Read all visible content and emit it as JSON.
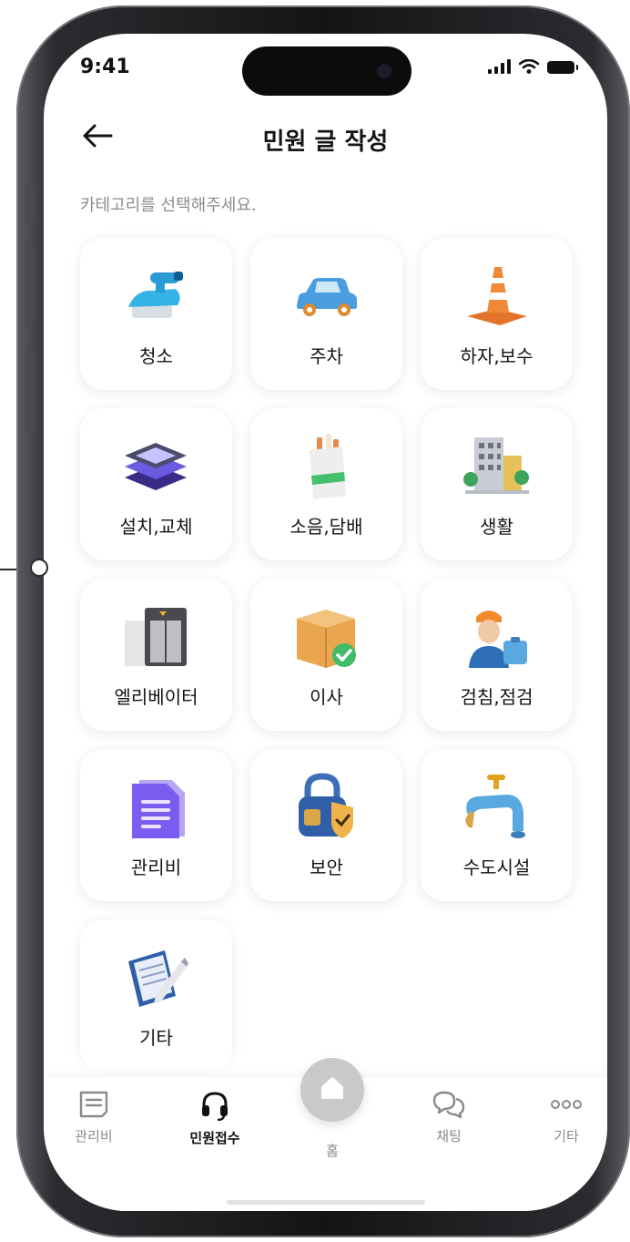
{
  "status_bar": {
    "time": "9:41"
  },
  "header": {
    "title": "민원 글 작성",
    "subtitle": "카테고리를 선택해주세요."
  },
  "categories": [
    {
      "label": "청소",
      "icon": "cleaning-brush-icon"
    },
    {
      "label": "주차",
      "icon": "car-icon"
    },
    {
      "label": "하자,보수",
      "icon": "traffic-cone-icon"
    },
    {
      "label": "설치,교체",
      "icon": "layers-icon"
    },
    {
      "label": "소음,담배",
      "icon": "cigarette-pack-icon"
    },
    {
      "label": "생활",
      "icon": "building-icon"
    },
    {
      "label": "엘리베이터",
      "icon": "elevator-icon"
    },
    {
      "label": "이사",
      "icon": "moving-box-icon"
    },
    {
      "label": "검침,점검",
      "icon": "inspector-icon"
    },
    {
      "label": "관리비",
      "icon": "document-icon"
    },
    {
      "label": "보안",
      "icon": "lock-shield-icon"
    },
    {
      "label": "수도시설",
      "icon": "faucet-icon"
    },
    {
      "label": "기타",
      "icon": "notepad-pencil-icon"
    }
  ],
  "nav": {
    "items": [
      {
        "label": "관리비",
        "icon": "receipt-icon",
        "active": false
      },
      {
        "label": "민원접수",
        "icon": "headset-icon",
        "active": true
      },
      {
        "label": "홈",
        "icon": "home-icon",
        "active": false
      },
      {
        "label": "채팅",
        "icon": "chat-icon",
        "active": false
      },
      {
        "label": "기타",
        "icon": "more-dots-icon",
        "active": false
      }
    ]
  },
  "colors": {
    "accent": "#111111",
    "muted": "#8a8a8a",
    "home_button": "#c9c9c9"
  }
}
